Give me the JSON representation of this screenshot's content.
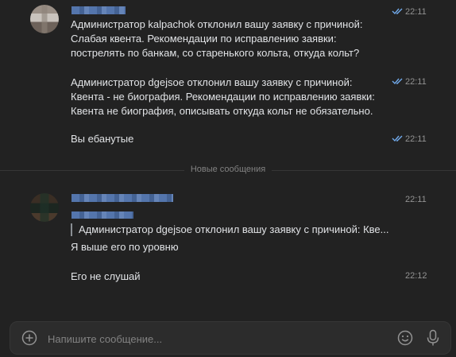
{
  "messages_group_1": {
    "message_1": {
      "text": "Администратор kalpachok отклонил вашу заявку с причиной:\nСлабая квента. Рекомендации по исправлению заявки:\nпострелять по банкам, со старенького кольта, откуда кольт?",
      "time": "22:11"
    },
    "message_2": {
      "text": "Администратор dgejsoe отклонил вашу заявку с причиной:\nКвента - не биография. Рекомендации по исправлению заявки:\nКвента не биография, описывать откуда кольт не обязательно.",
      "time": "22:11"
    },
    "message_3": {
      "text": "Вы ебанутые",
      "time": "22:11"
    }
  },
  "divider": {
    "label": "Новые сообщения"
  },
  "messages_group_2": {
    "header_time": "22:11",
    "reply_preview": "Администратор dgejsoe отклонил вашу заявку с причиной: Кве...",
    "message_1": {
      "text": "Я выше его по уровню"
    },
    "message_2": {
      "text": "Его не слушай",
      "time": "22:12"
    }
  },
  "composer": {
    "placeholder": "Напишите сообщение..."
  },
  "colors": {
    "background": "#222222",
    "text": "#e1e3e6",
    "muted": "#939393",
    "accent": "#5d84c4",
    "read_check": "#71aaeb"
  },
  "icons": {
    "add": "plus-circle-icon",
    "emoji": "smile-icon",
    "voice": "microphone-icon",
    "read": "double-check-icon"
  }
}
